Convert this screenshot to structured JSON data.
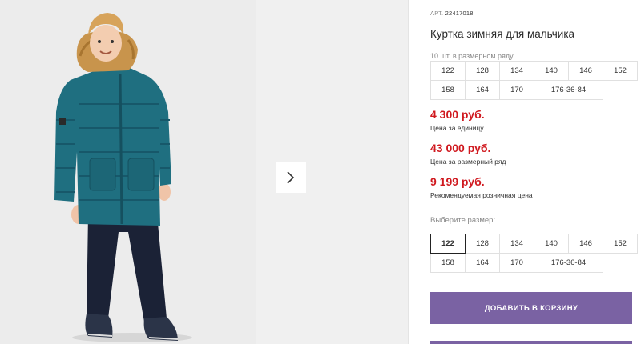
{
  "product": {
    "article_prefix": "АРТ.",
    "article_number": "22417018",
    "title": "Куртка зимняя для мальчика",
    "pack_note": "10 шт. в размерном ряду"
  },
  "size_row": [
    "122",
    "128",
    "134",
    "140",
    "146",
    "152",
    "158",
    "164",
    "170",
    "176-36-84"
  ],
  "prices": {
    "unit_price": "4 300 руб.",
    "unit_label": "Цена за единицу",
    "row_price": "43 000 руб.",
    "row_label": "Цена за размерный ряд",
    "retail_price": "9 199 руб.",
    "retail_label": "Рекомендуемая розничная цена"
  },
  "size_select": {
    "label": "Выберите размер:",
    "options": [
      "122",
      "128",
      "134",
      "140",
      "146",
      "152",
      "158",
      "164",
      "170",
      "176-36-84"
    ],
    "selected": "122"
  },
  "cart_button_label": "ДОБАВИТЬ В КОРЗИНУ",
  "colors": {
    "price": "#d0191f",
    "accent": "#7a62a3",
    "jacket": "#1f6f80"
  },
  "icons": {
    "next": "chevron-right-icon"
  }
}
